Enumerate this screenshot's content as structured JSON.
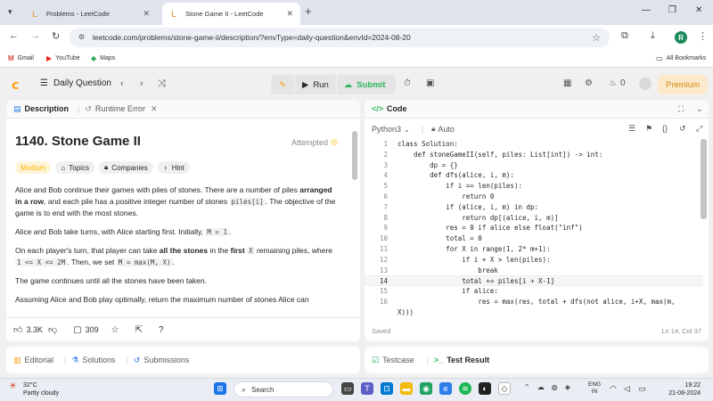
{
  "browser": {
    "tabs": [
      {
        "title": "Problems - LeetCode"
      },
      {
        "title": "Stone Game II - LeetCode"
      }
    ],
    "url": "leetcode.com/problems/stone-game-ii/description/?envType=daily-question&envId=2024-08-20",
    "profile_initial": "R",
    "bookmarks": [
      {
        "label": "Gmail"
      },
      {
        "label": "YouTube"
      },
      {
        "label": "Maps"
      }
    ],
    "all_bookmarks": "All Bookmarks"
  },
  "header": {
    "daily_question": "Daily Question",
    "run": "Run",
    "submit": "Submit",
    "streak_count": "0",
    "premium": "Premium"
  },
  "left": {
    "tabs": [
      {
        "label": "Description"
      },
      {
        "label": "Runtime Error"
      }
    ],
    "title": "1140. Stone Game II",
    "attempted": "Attempted",
    "tags": [
      {
        "label": "Medium"
      },
      {
        "label": "Topics"
      },
      {
        "label": "Companies"
      },
      {
        "label": "Hint"
      }
    ],
    "desc": {
      "p1a": "Alice and Bob continue their games with piles of stones.  There are a number of piles ",
      "p1b": "arranged in a row",
      "p1c": ", and each pile has a positive integer number of stones ",
      "p1code": "piles[i]",
      "p1d": ".  The objective of the game is to end with the most stones.",
      "p2a": "Alice and Bob take turns, with Alice starting first.  Initially, ",
      "p2code": "M = 1",
      "p2b": ".",
      "p3a": "On each player's turn, that player can take ",
      "p3b": "all the stones",
      "p3c": " in the ",
      "p3d": "first",
      "p3e": " ",
      "p3code1": "X",
      "p3f": " remaining piles, where ",
      "p3code2": "1 <= X <= 2M",
      "p3g": ".  Then, we set ",
      "p3code3": "M = max(M, X)",
      "p3h": ".",
      "p4": "The game continues until all the stones have been taken.",
      "p5": "Assuming Alice and Bob play optimally, return the maximum number of stones Alice can"
    },
    "footer": {
      "likes": "3.3K",
      "comments": "309"
    },
    "bottom_tabs": [
      {
        "label": "Editorial"
      },
      {
        "label": "Solutions"
      },
      {
        "label": "Submissions"
      }
    ]
  },
  "right": {
    "tab": "Code",
    "language": "Python3",
    "mode": "Auto",
    "status_saved": "Saved",
    "cursor_pos": "Ln 14, Col 37",
    "code_lines": [
      {
        "n": "1",
        "text": "class Solution:"
      },
      {
        "n": "2",
        "text": "    def stoneGameII(self, piles: List[int]) -> int:"
      },
      {
        "n": "3",
        "text": "        dp = {}"
      },
      {
        "n": "4",
        "text": "        def dfs(alice, i, m):"
      },
      {
        "n": "5",
        "text": "            if i == len(piles):"
      },
      {
        "n": "6",
        "text": "                return 0"
      },
      {
        "n": "7",
        "text": "            if (alice, i, m) in dp:"
      },
      {
        "n": "8",
        "text": "                return dp[(alice, i, m)]"
      },
      {
        "n": "9",
        "text": "            res = 0 if alice else float(\"inf\")"
      },
      {
        "n": "10",
        "text": "            total = 0"
      },
      {
        "n": "11",
        "text": "            for X in range(1, 2* m+1):"
      },
      {
        "n": "12",
        "text": "                if i + X > len(piles):"
      },
      {
        "n": "13",
        "text": "                    break"
      },
      {
        "n": "14",
        "text": "                total += piles[i + X-1]"
      },
      {
        "n": "15",
        "text": "                if alice:"
      },
      {
        "n": "16",
        "text": "                    res = max(res, total + dfs(not alice, i+X, max(m,"
      },
      {
        "n": "",
        "text": "X)))"
      }
    ],
    "bottom_tabs": [
      {
        "label": "Testcase"
      },
      {
        "label": "Test Result"
      }
    ]
  },
  "taskbar": {
    "weather_temp": "32°C",
    "weather_desc": "Partly cloudy",
    "search": "Search",
    "lang1": "ENG",
    "lang2": "IN",
    "time": "19:22",
    "date": "21-08-2024"
  }
}
